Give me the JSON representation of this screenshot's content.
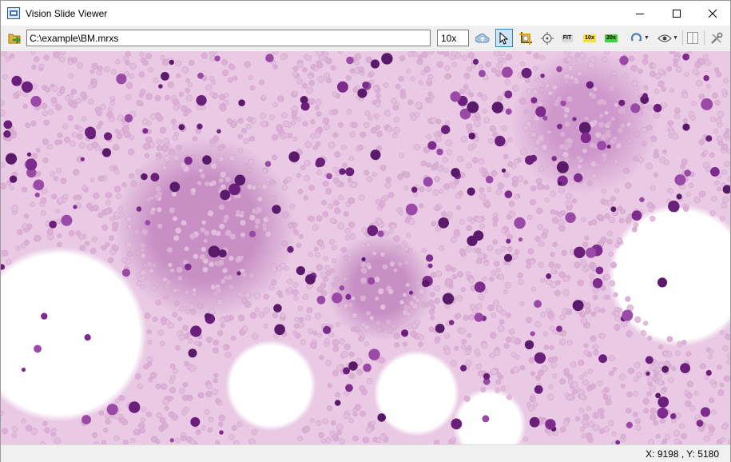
{
  "window": {
    "title": "Vision Slide Viewer"
  },
  "toolbar": {
    "path_value": "C:\\example\\BM.mrxs",
    "zoom_value": "10x",
    "fit_label": "FIT",
    "zoom10_label": "10x",
    "zoom20_label": "20x",
    "icons": [
      "open-folder-icon",
      "cloud-upload-icon",
      "pointer-icon",
      "crop-icon",
      "crosshair-icon",
      "rotate-icon",
      "eye-icon",
      "split-view-icon",
      "tools-icon"
    ],
    "active_tool": "pointer",
    "colors": {
      "zoom10_bg": "#f3e23b",
      "zoom20_bg": "#3fd23f",
      "fit_bg": "#d8d8d8",
      "selected_bg": "#cce4f7"
    }
  },
  "viewer": {
    "image_description_colors": {
      "background": "#e9c9e4",
      "cell": "#6a1f7a"
    }
  },
  "status": {
    "coordinates": "X: 9198 , Y: 5180"
  }
}
